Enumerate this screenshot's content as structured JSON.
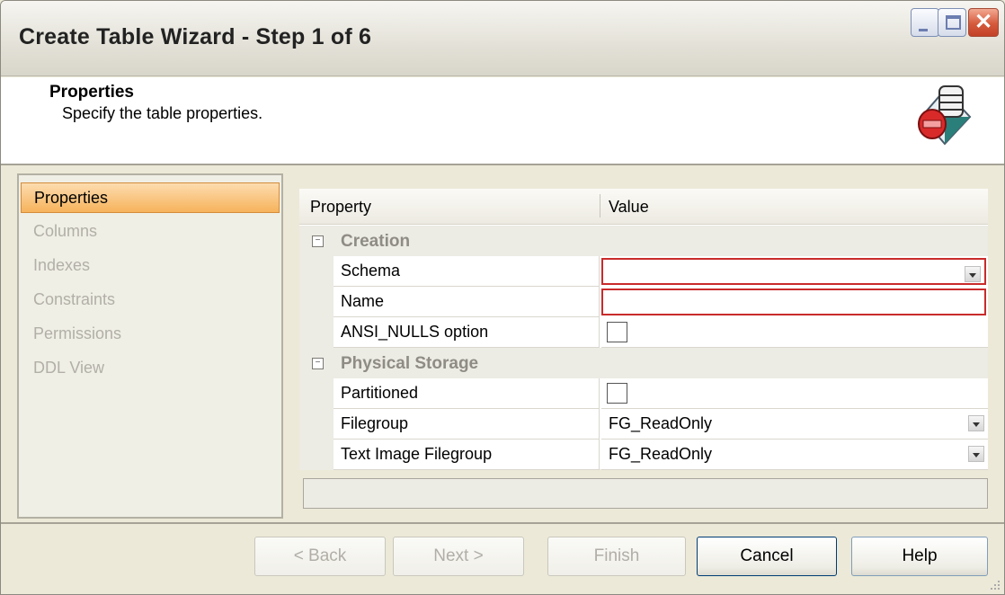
{
  "window": {
    "title": "Create Table Wizard - Step 1 of 6"
  },
  "titlebar_buttons": {
    "minimize": "minimize-icon",
    "maximize": "maximize-icon",
    "close": "close-icon",
    "close_glyph": "✕"
  },
  "header": {
    "title": "Properties",
    "subtitle": "Specify the table properties.",
    "icon": "database-table-icon"
  },
  "nav": {
    "items": [
      {
        "label": "Properties",
        "active": true
      },
      {
        "label": "Columns",
        "active": false
      },
      {
        "label": "Indexes",
        "active": false
      },
      {
        "label": "Constraints",
        "active": false
      },
      {
        "label": "Permissions",
        "active": false
      },
      {
        "label": "DDL View",
        "active": false
      }
    ]
  },
  "grid": {
    "header": {
      "property": "Property",
      "value": "Value"
    },
    "categories": [
      {
        "label": "Creation",
        "rows": [
          {
            "name": "Schema",
            "value": "",
            "type": "dropdown",
            "required": true
          },
          {
            "name": "Name",
            "value": "",
            "type": "text",
            "required": true
          },
          {
            "name": "ANSI_NULLS option",
            "checked": false,
            "type": "checkbox"
          }
        ]
      },
      {
        "label": "Physical Storage",
        "rows": [
          {
            "name": "Partitioned",
            "checked": false,
            "type": "checkbox"
          },
          {
            "name": "Filegroup",
            "value": "FG_ReadOnly",
            "type": "dropdown"
          },
          {
            "name": "Text Image Filegroup",
            "value": "FG_ReadOnly",
            "type": "dropdown"
          }
        ]
      }
    ]
  },
  "footer": {
    "back": "< Back",
    "next": "Next >",
    "finish": "Finish",
    "cancel": "Cancel",
    "help": "Help"
  },
  "colors": {
    "active_nav": "#f6b35b",
    "required_border": "#c92b2b",
    "close_button": "#d55a3c"
  }
}
